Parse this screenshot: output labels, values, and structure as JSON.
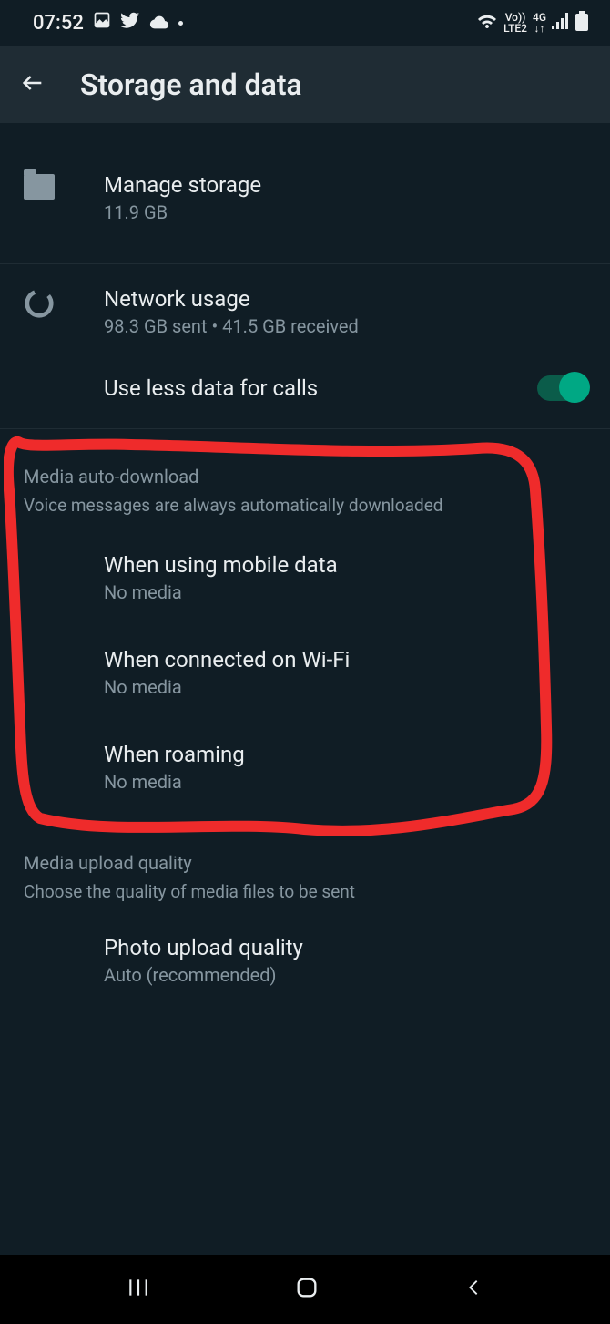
{
  "status": {
    "time": "07:52",
    "net1": "Vo))",
    "net2": "LTE2",
    "net3": "4G"
  },
  "header": {
    "title": "Storage and data"
  },
  "storage": {
    "manage_title": "Manage storage",
    "manage_sub": "11.9 GB",
    "network_title": "Network usage",
    "network_sub": "98.3 GB sent • 41.5 GB received",
    "less_data_title": "Use less data for calls"
  },
  "auto_download": {
    "label": "Media auto-download",
    "desc": "Voice messages are always automatically downloaded",
    "mobile_title": "When using mobile data",
    "mobile_sub": "No media",
    "wifi_title": "When connected on Wi-Fi",
    "wifi_sub": "No media",
    "roaming_title": "When roaming",
    "roaming_sub": "No media"
  },
  "upload": {
    "label": "Media upload quality",
    "desc": "Choose the quality of media files to be sent",
    "photo_title": "Photo upload quality",
    "photo_sub": "Auto (recommended)"
  }
}
